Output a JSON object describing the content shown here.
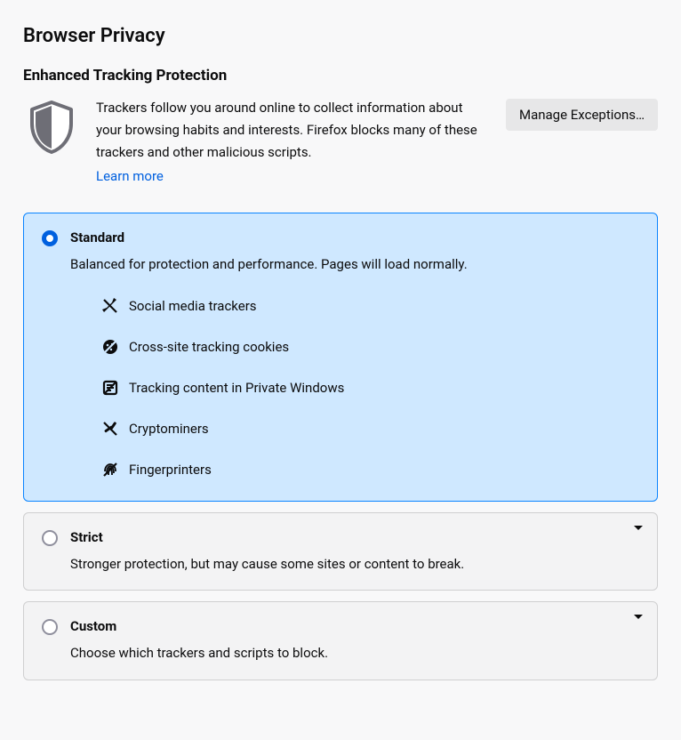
{
  "page_title": "Browser Privacy",
  "etp": {
    "heading": "Enhanced Tracking Protection",
    "description": "Trackers follow you around online to collect information about your browsing habits and interests. Firefox blocks many of these trackers and other malicious scripts.",
    "learn_more": "Learn more",
    "manage_exceptions": "Manage Exceptions…"
  },
  "options": {
    "standard": {
      "title": "Standard",
      "desc": "Balanced for protection and performance. Pages will load normally.",
      "items": {
        "social": "Social media trackers",
        "cookies": "Cross-site tracking cookies",
        "content": "Tracking content in Private Windows",
        "crypto": "Cryptominers",
        "finger": "Fingerprinters"
      }
    },
    "strict": {
      "title": "Strict",
      "desc": "Stronger protection, but may cause some sites or content to break."
    },
    "custom": {
      "title": "Custom",
      "desc": "Choose which trackers and scripts to block."
    }
  }
}
